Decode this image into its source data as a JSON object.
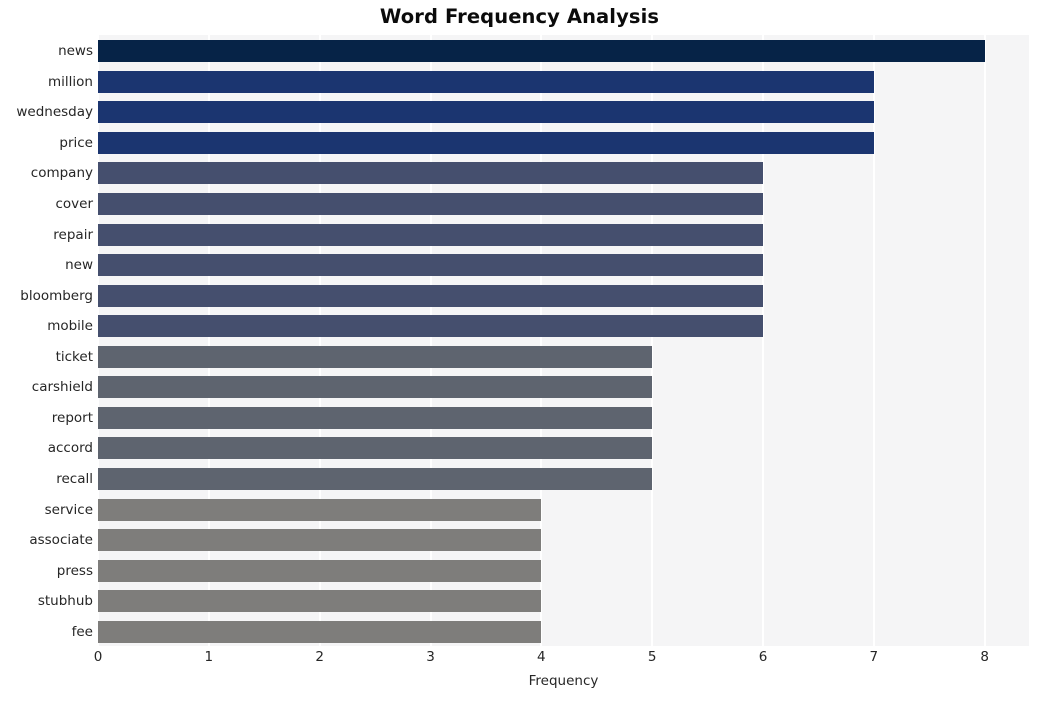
{
  "chart_data": {
    "type": "bar",
    "orientation": "horizontal",
    "title": "Word Frequency Analysis",
    "xlabel": "Frequency",
    "ylabel": "",
    "xlim": [
      0,
      8.4
    ],
    "ylim": [
      0,
      20
    ],
    "grid": true,
    "legend": false,
    "legend_position": "none",
    "plot_background": "#f5f5f6",
    "gridline_color": "#ffffff",
    "categories": [
      "news",
      "million",
      "wednesday",
      "price",
      "company",
      "cover",
      "repair",
      "new",
      "bloomberg",
      "mobile",
      "ticket",
      "carshield",
      "report",
      "accord",
      "recall",
      "service",
      "associate",
      "press",
      "stubhub",
      "fee"
    ],
    "values": [
      8,
      7,
      7,
      7,
      6,
      6,
      6,
      6,
      6,
      6,
      5,
      5,
      5,
      5,
      5,
      4,
      4,
      4,
      4,
      4
    ],
    "bar_colors": [
      "#062347",
      "#1b3570",
      "#1b3570",
      "#1b3570",
      "#454f6e",
      "#454f6e",
      "#454f6e",
      "#454f6e",
      "#454f6e",
      "#454f6e",
      "#5e646f",
      "#5e646f",
      "#5e646f",
      "#5e646f",
      "#5e646f",
      "#7e7d7b",
      "#7e7d7b",
      "#7e7d7b",
      "#7e7d7b",
      "#7e7d7b"
    ],
    "x_ticks": [
      0,
      1,
      2,
      3,
      4,
      5,
      6,
      7,
      8
    ],
    "x_tick_labels": [
      "0",
      "1",
      "2",
      "3",
      "4",
      "5",
      "6",
      "7",
      "8"
    ]
  }
}
